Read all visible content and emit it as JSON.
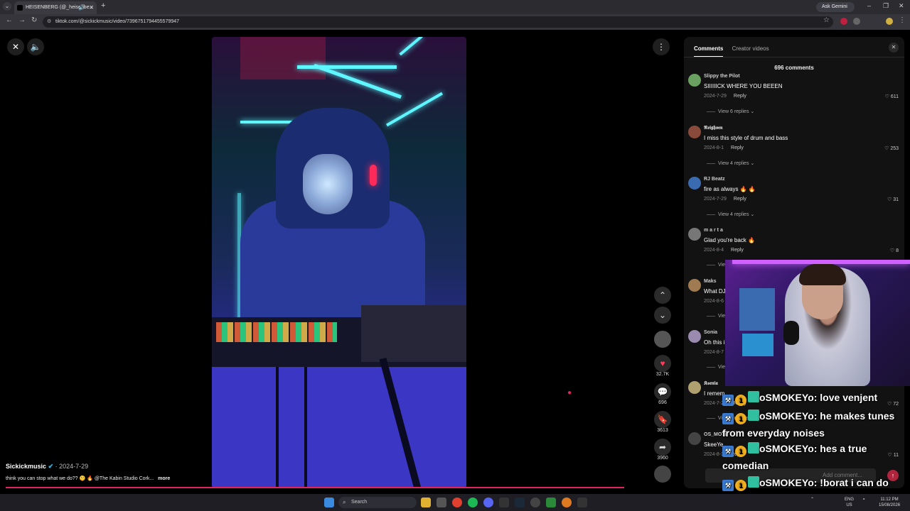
{
  "browser": {
    "tab_title": "HEISENBERG (@_heisenbe...",
    "tab_sound_icon": "speaker-icon",
    "new_tab": "+",
    "gemini_label": "Ask Gemini",
    "url": "tiktok.com/@sickickmusic/video/7396751794455579947"
  },
  "video": {
    "author": "Sickickmusic",
    "date": "· 2024-7-29",
    "caption": "think you can stop what we do?? 🤫 🔥 @The Kabin Studio Cork...",
    "more": "more",
    "likes": "32.7K",
    "comments": "696",
    "saves": "3613",
    "shares": "3960"
  },
  "comments_panel": {
    "tab_comments": "Comments",
    "tab_creator": "Creator videos",
    "count": "696 comments",
    "items": [
      {
        "name": "Slippy the Pilot",
        "text": "SIIIIIICK WHERE YOU BEEEN",
        "date": "2024-7-29",
        "reply": "Reply",
        "likes": "611",
        "replies": "View 6 replies ⌄",
        "avatar": "#6aa060"
      },
      {
        "name": "𝕽𝖊𝖎𝖌𝖍𝖔𝖊𝖓",
        "text": "I miss this style of drum and bass",
        "date": "2024-8-1",
        "reply": "Reply",
        "likes": "253",
        "replies": "View 4 replies ⌄",
        "avatar": "#8a4a3a"
      },
      {
        "name": "RJ Beatz",
        "text": "fire as always 🔥 🔥",
        "date": "2024-7-29",
        "reply": "Reply",
        "likes": "31",
        "replies": "View 4 replies ⌄",
        "avatar": "#3a6ab0"
      },
      {
        "name": "m a r t a",
        "text": "Glad you're back 🔥",
        "date": "2024-8-4",
        "reply": "Reply",
        "likes": "8",
        "replies": "View",
        "avatar": "#777"
      },
      {
        "name": "Maks",
        "text": "What DJ",
        "date": "2024-8-6",
        "reply": "",
        "likes": "",
        "replies": "View",
        "avatar": "#a07a50"
      },
      {
        "name": "Sonia",
        "text": "Oh this i",
        "date": "2024-8-7",
        "reply": "",
        "likes": "",
        "replies": "View",
        "avatar": "#9a8ab0"
      },
      {
        "name": "𝕶𝖘𝖊𝖓𝖎𝖆",
        "text": "I remem",
        "date": "2024-7-29",
        "reply": "Reply",
        "likes": "72",
        "replies": "View 3 replies",
        "avatar": "#b0a070"
      },
      {
        "name": "OS_MOTE",
        "text": "SkeeYe",
        "date": "2024-8-3",
        "reply": "Reply",
        "likes": "11",
        "replies": "",
        "avatar": "#444"
      }
    ],
    "add_comment_placeholder": "Add comment..."
  },
  "chat": [
    {
      "user": "oSMOKEYo:",
      "message": "love venjent"
    },
    {
      "user": "oSMOKEYo:",
      "message": "he makes tunes from everyday noises"
    },
    {
      "user": "oSMOKEYo:",
      "message": "hes a true comedian"
    },
    {
      "user": "oSMOKEYo:",
      "message": "!borat i can do better"
    }
  ],
  "taskbar": {
    "search_label": "Search",
    "lang": "ENG",
    "region": "US",
    "time": "11:12 PM",
    "date": "15/08/2026"
  },
  "colors": {
    "tiktok_red": "#e0245e",
    "like_red": "#ff3b5c",
    "panel_bg": "#121212"
  }
}
